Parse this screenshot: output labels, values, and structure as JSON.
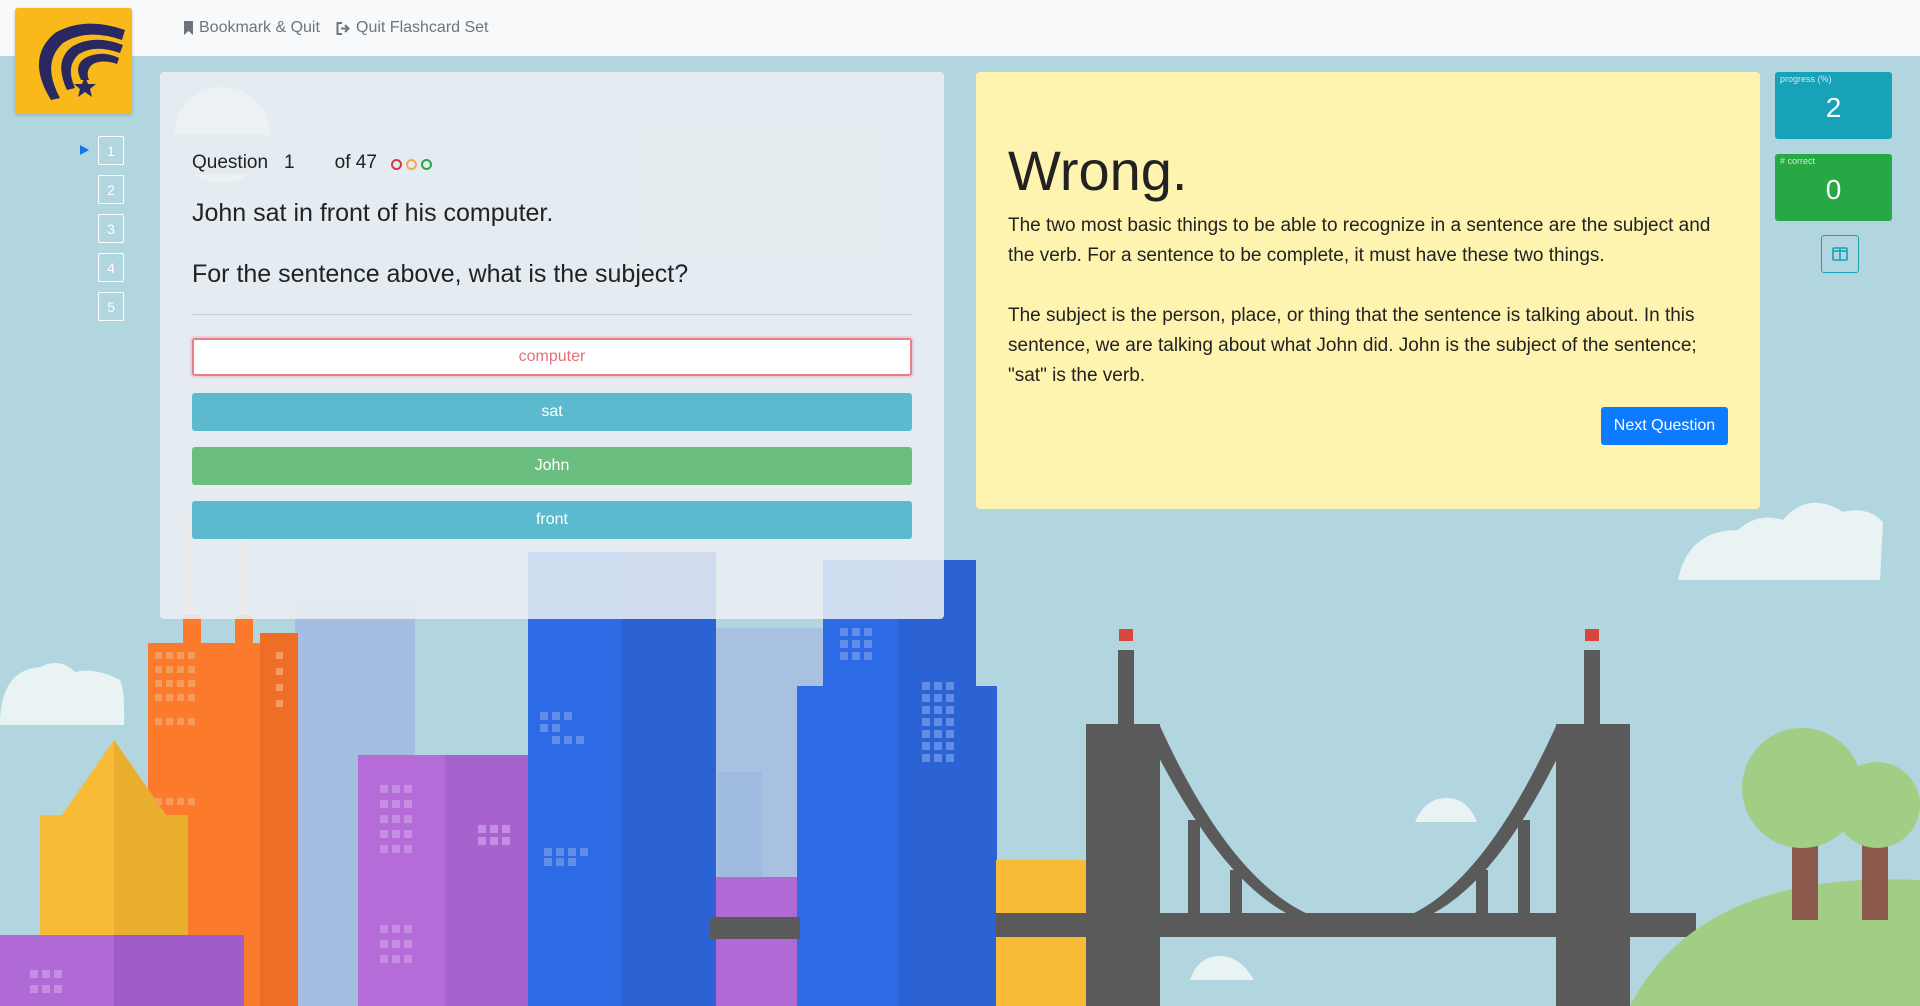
{
  "nav": {
    "bookmark_quit": "Bookmark & Quit",
    "quit_set": "Quit Flashcard Set"
  },
  "question_list": [
    "1",
    "2",
    "3",
    "4",
    "5"
  ],
  "question": {
    "label": "Question",
    "number": "1",
    "of_total": "of 47",
    "text": "John sat in front of his computer.",
    "prompt": "For the sentence above, what is the subject?",
    "dot_colors": [
      "#dc3545",
      "#f0ad4e",
      "#28a745"
    ],
    "answers": [
      {
        "label": "computer",
        "state": "wrong",
        "bg": "#ffffff",
        "color": "#e0707c",
        "border": "#e77e8a"
      },
      {
        "label": "sat",
        "state": "neutral",
        "bg": "#5bbacd",
        "color": "#ffffff",
        "border": "#5bbacd"
      },
      {
        "label": "John",
        "state": "correct",
        "bg": "#6abf80",
        "color": "#ffffff",
        "border": "#6abf80"
      },
      {
        "label": "front",
        "state": "neutral",
        "bg": "#5bbacd",
        "color": "#ffffff",
        "border": "#5bbacd"
      }
    ]
  },
  "feedback": {
    "title": "Wrong.",
    "para1": "The two most basic things to be able to recognize in a sentence are the subject and the verb. For a sentence to be complete, it must have these two things.",
    "para2": "The subject is the person, place, or thing that the sentence is talking about. In this sentence, we are talking about what John did. John is the subject of the sentence; \"sat\" is the verb.",
    "next_label": "Next Question"
  },
  "stats": {
    "progress_label": "progress (%)",
    "progress_value": "2",
    "correct_label": "# correct",
    "correct_value": "0"
  },
  "icons": {
    "bookmark": "bookmark-icon",
    "quit": "sign-out-icon",
    "layout": "columns-icon",
    "current": "play-arrow-icon"
  },
  "colors": {
    "brand": "#f9b91a",
    "progress": "#17a2b8",
    "correct": "#28a745",
    "primary": "#0d7bfd"
  }
}
